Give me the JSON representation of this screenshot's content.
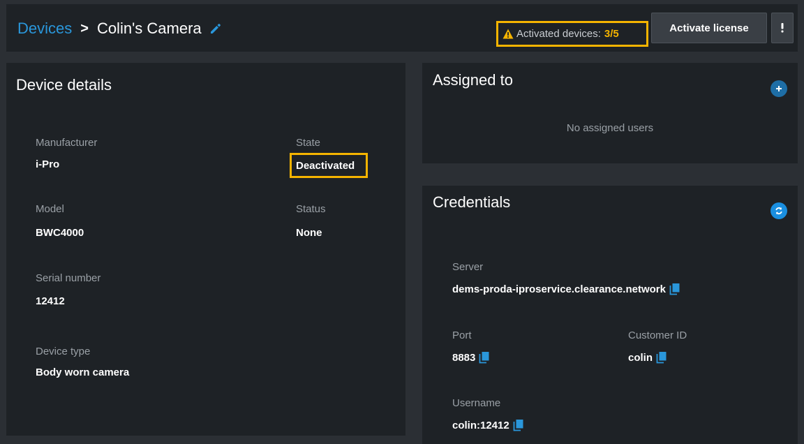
{
  "header": {
    "breadcrumb_root": "Devices",
    "breadcrumb_sep": ">",
    "device_name": "Colin's Camera",
    "activated_label": "Activated devices:",
    "activated_count": "3/5",
    "activate_license_label": "Activate license"
  },
  "details": {
    "title": "Device details",
    "manufacturer_label": "Manufacturer",
    "manufacturer_value": "i-Pro",
    "state_label": "State",
    "state_value": "Deactivated",
    "model_label": "Model",
    "model_value": "BWC4000",
    "status_label": "Status",
    "status_value": "None",
    "serial_label": "Serial number",
    "serial_value": "12412",
    "device_type_label": "Device type",
    "device_type_value": "Body worn camera"
  },
  "assigned": {
    "title": "Assigned to",
    "empty_text": "No assigned users"
  },
  "credentials": {
    "title": "Credentials",
    "server_label": "Server",
    "server_value": "dems-proda-iproservice.clearance.network",
    "port_label": "Port",
    "port_value": "8883",
    "customer_id_label": "Customer ID",
    "customer_id_value": "colin",
    "username_label": "Username",
    "username_value": "colin:12412"
  },
  "colors": {
    "accent": "#2a97db",
    "warning": "#f5b400",
    "background": "#2b2f34",
    "panel": "#1e2226"
  },
  "icons": [
    "edit-icon",
    "warning-icon",
    "more-vertical-icon",
    "plus-icon",
    "refresh-icon",
    "copy-icon"
  ]
}
